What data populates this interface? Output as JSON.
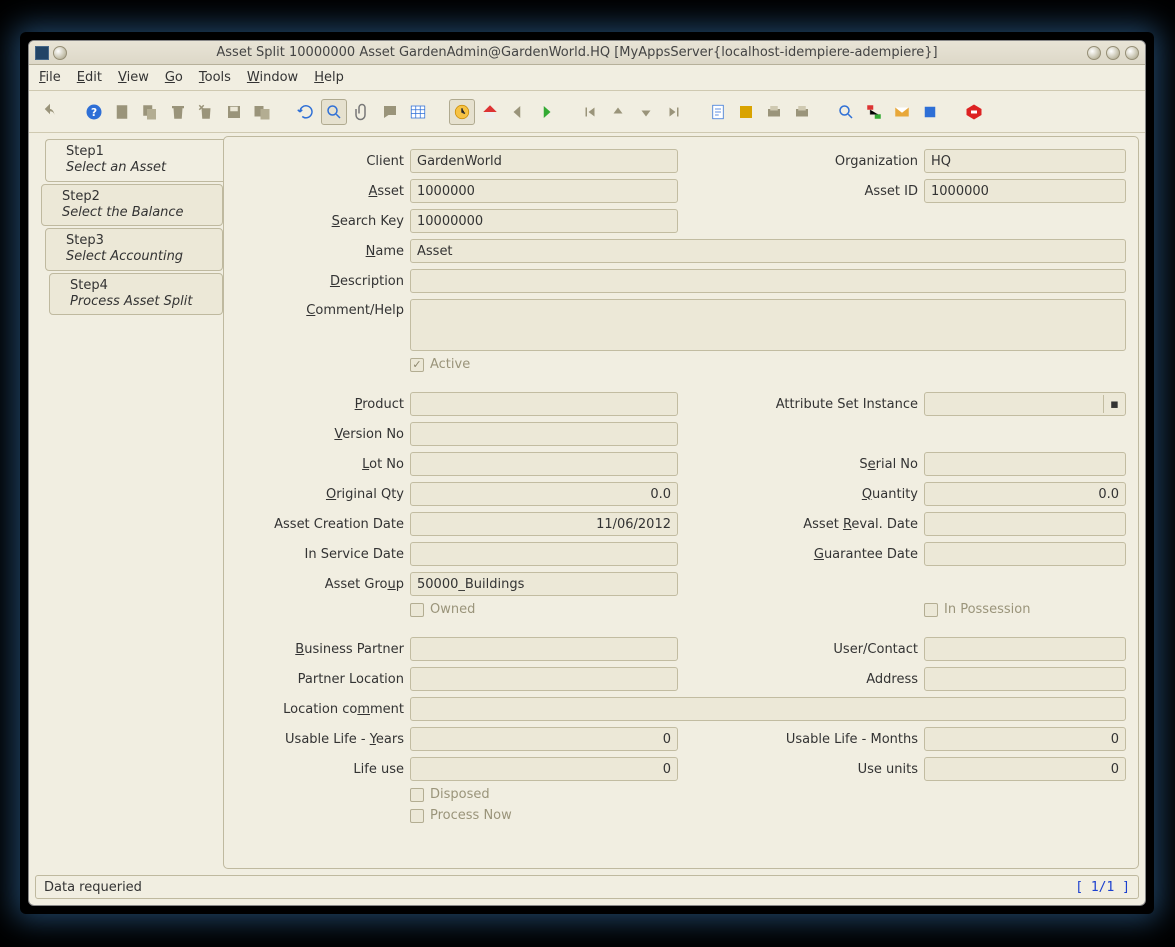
{
  "window": {
    "title": "Asset Split  10000000  Asset  GardenAdmin@GardenWorld.HQ [MyAppsServer{localhost-idempiere-adempiere}]"
  },
  "menubar": [
    "File",
    "Edit",
    "View",
    "Go",
    "Tools",
    "Window",
    "Help"
  ],
  "sidebar": {
    "steps": [
      {
        "title": "Step1",
        "subtitle": "Select an Asset"
      },
      {
        "title": "Step2",
        "subtitle": "Select the Balance"
      },
      {
        "title": "Step3",
        "subtitle": "Select Accounting"
      },
      {
        "title": "Step4",
        "subtitle": "Process Asset Split"
      }
    ]
  },
  "labels": {
    "client": "Client",
    "organization": "Organization",
    "asset": "Asset",
    "asset_id": "Asset ID",
    "search_key": "Search Key",
    "name": "Name",
    "description": "Description",
    "comment_help": "Comment/Help",
    "active": "Active",
    "product": "Product",
    "attr_set_instance": "Attribute Set Instance",
    "version_no": "Version No",
    "lot_no": "Lot No",
    "serial_no": "Serial No",
    "original_qty": "Original Qty",
    "quantity": "Quantity",
    "asset_creation_date": "Asset Creation Date",
    "asset_reval_date": "Asset Reval. Date",
    "in_service_date": "In Service Date",
    "guarantee_date": "Guarantee Date",
    "asset_group": "Asset Group",
    "owned": "Owned",
    "in_possession": "In Possession",
    "business_partner": "Business Partner",
    "user_contact": "User/Contact",
    "partner_location": "Partner Location",
    "address": "Address",
    "location_comment": "Location comment",
    "usable_life_years": "Usable Life - Years",
    "usable_life_months": "Usable Life - Months",
    "life_use": "Life use",
    "use_units": "Use units",
    "disposed": "Disposed",
    "process_now": "Process Now"
  },
  "fields": {
    "client": "GardenWorld",
    "organization": "HQ",
    "asset": "1000000",
    "asset_id": "1000000",
    "search_key": "10000000",
    "name": "Asset",
    "description": "",
    "comment_help": "",
    "active_checked": true,
    "product": "",
    "attr_set_instance": "",
    "version_no": "",
    "lot_no": "",
    "serial_no": "",
    "original_qty": "0.0",
    "quantity": "0.0",
    "asset_creation_date": "11/06/2012",
    "asset_reval_date": "",
    "in_service_date": "",
    "guarantee_date": "",
    "asset_group": "50000_Buildings",
    "owned_checked": false,
    "in_possession_checked": false,
    "business_partner": "",
    "user_contact": "",
    "partner_location": "",
    "address": "",
    "location_comment": "",
    "usable_life_years": "0",
    "usable_life_months": "0",
    "life_use": "0",
    "use_units": "0",
    "disposed_checked": false,
    "process_now_checked": false
  },
  "status": {
    "message": "Data requeried",
    "pager": "[  1/1  ]"
  }
}
